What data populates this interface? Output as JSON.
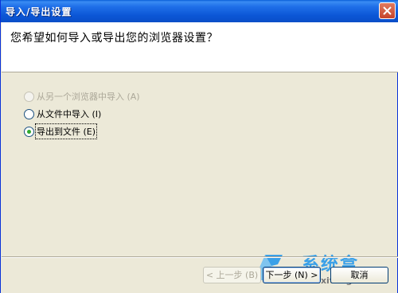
{
  "window": {
    "title": "导入/导出设置"
  },
  "header": {
    "question": "您希望如何导入或导出您的浏览器设置？"
  },
  "options": [
    {
      "label": "从另一个浏览器中导入 (A)",
      "enabled": false,
      "selected": false
    },
    {
      "label": "从文件中导入 (I)",
      "enabled": true,
      "selected": false
    },
    {
      "label": "导出到文件 (E)",
      "enabled": true,
      "selected": true
    }
  ],
  "buttons": {
    "back": "< 上一步 (B)",
    "next": "下一步 (N) >",
    "cancel": "取消"
  },
  "watermark": {
    "name": "系统盒",
    "url": "www.xitonghe.com"
  },
  "colors": {
    "titlebar": "#0a5fd8",
    "dialog_bg": "#ece9d8",
    "radio_dot": "#2fa92f"
  }
}
